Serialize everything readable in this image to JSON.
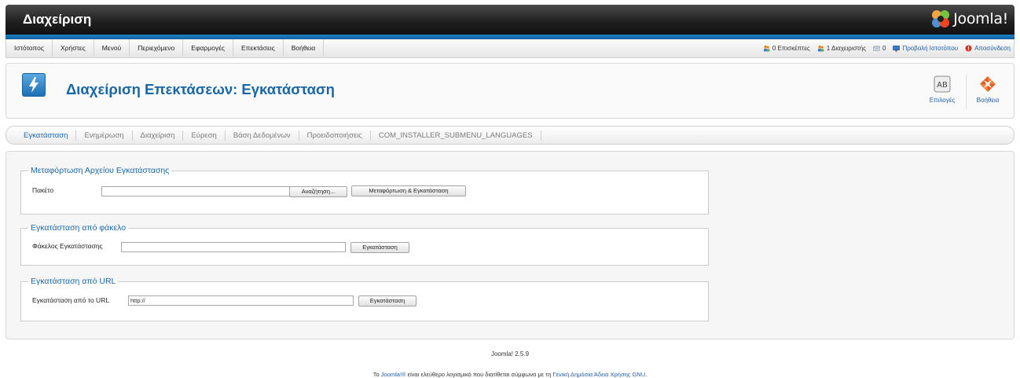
{
  "header": {
    "title": "Διαχείριση",
    "logo_text": "Joomla!"
  },
  "menu": {
    "items": [
      {
        "label": "Ιστότοπος"
      },
      {
        "label": "Χρήστες"
      },
      {
        "label": "Μενού"
      },
      {
        "label": "Περιεχόμενο"
      },
      {
        "label": "Εφαρμογές"
      },
      {
        "label": "Επεκτάσεις"
      },
      {
        "label": "Βοήθεια"
      }
    ]
  },
  "status": {
    "visitors": "0 Επισκέπτες",
    "admins": "1 Διαχειριστής",
    "messages": "0",
    "view_site": "Προβολή Ιστοτόπου",
    "logout": "Αποσύνδεση"
  },
  "page": {
    "title": "Διαχείριση Επεκτάσεων: Εγκατάσταση"
  },
  "toolbar": {
    "options_label": "Επιλογές",
    "help_label": "Βοήθεια"
  },
  "submenu": {
    "tabs": [
      {
        "label": "Εγκατάσταση",
        "active": true
      },
      {
        "label": "Ενημέρωση"
      },
      {
        "label": "Διαχείριση"
      },
      {
        "label": "Εύρεση"
      },
      {
        "label": "Βάση Δεδομένων"
      },
      {
        "label": "Προειδοποιήσεις"
      },
      {
        "label": "COM_INSTALLER_SUBMENU_LANGUAGES"
      }
    ]
  },
  "upload": {
    "legend": "Μεταφόρτωση Αρχείου Εγκατάστασης",
    "package_label": "Πακέτο",
    "file_value": "",
    "browse_label": "Αναζήτηση...",
    "submit_label": "Μεταφόρτωση & Εγκατάσταση"
  },
  "folder": {
    "legend": "Εγκατάσταση από φάκελο",
    "label": "Φάκελος Εγκατάστασης",
    "value": "",
    "submit_label": "Εγκατάσταση"
  },
  "url": {
    "legend": "Εγκατάσταση από URL",
    "label": "Εγκατάσταση από το URL",
    "value": "http://",
    "submit_label": "Εγκατάσταση"
  },
  "footer": {
    "version": "Joomla! 2.5.9",
    "license_prefix": "Το ",
    "license_brand": "Joomla!®",
    "license_middle": " είναι ελεύθερο λογισμικό που διατίθεται σύμφωνα με τη ",
    "license_link": "Γενική Δημόσια Άδεια Χρήσης GNU",
    "license_suffix": "."
  },
  "colors": {
    "accent_blue": "#1a67a6",
    "header_dark": "#1e1e1e",
    "header_line": "#1d83c4"
  }
}
